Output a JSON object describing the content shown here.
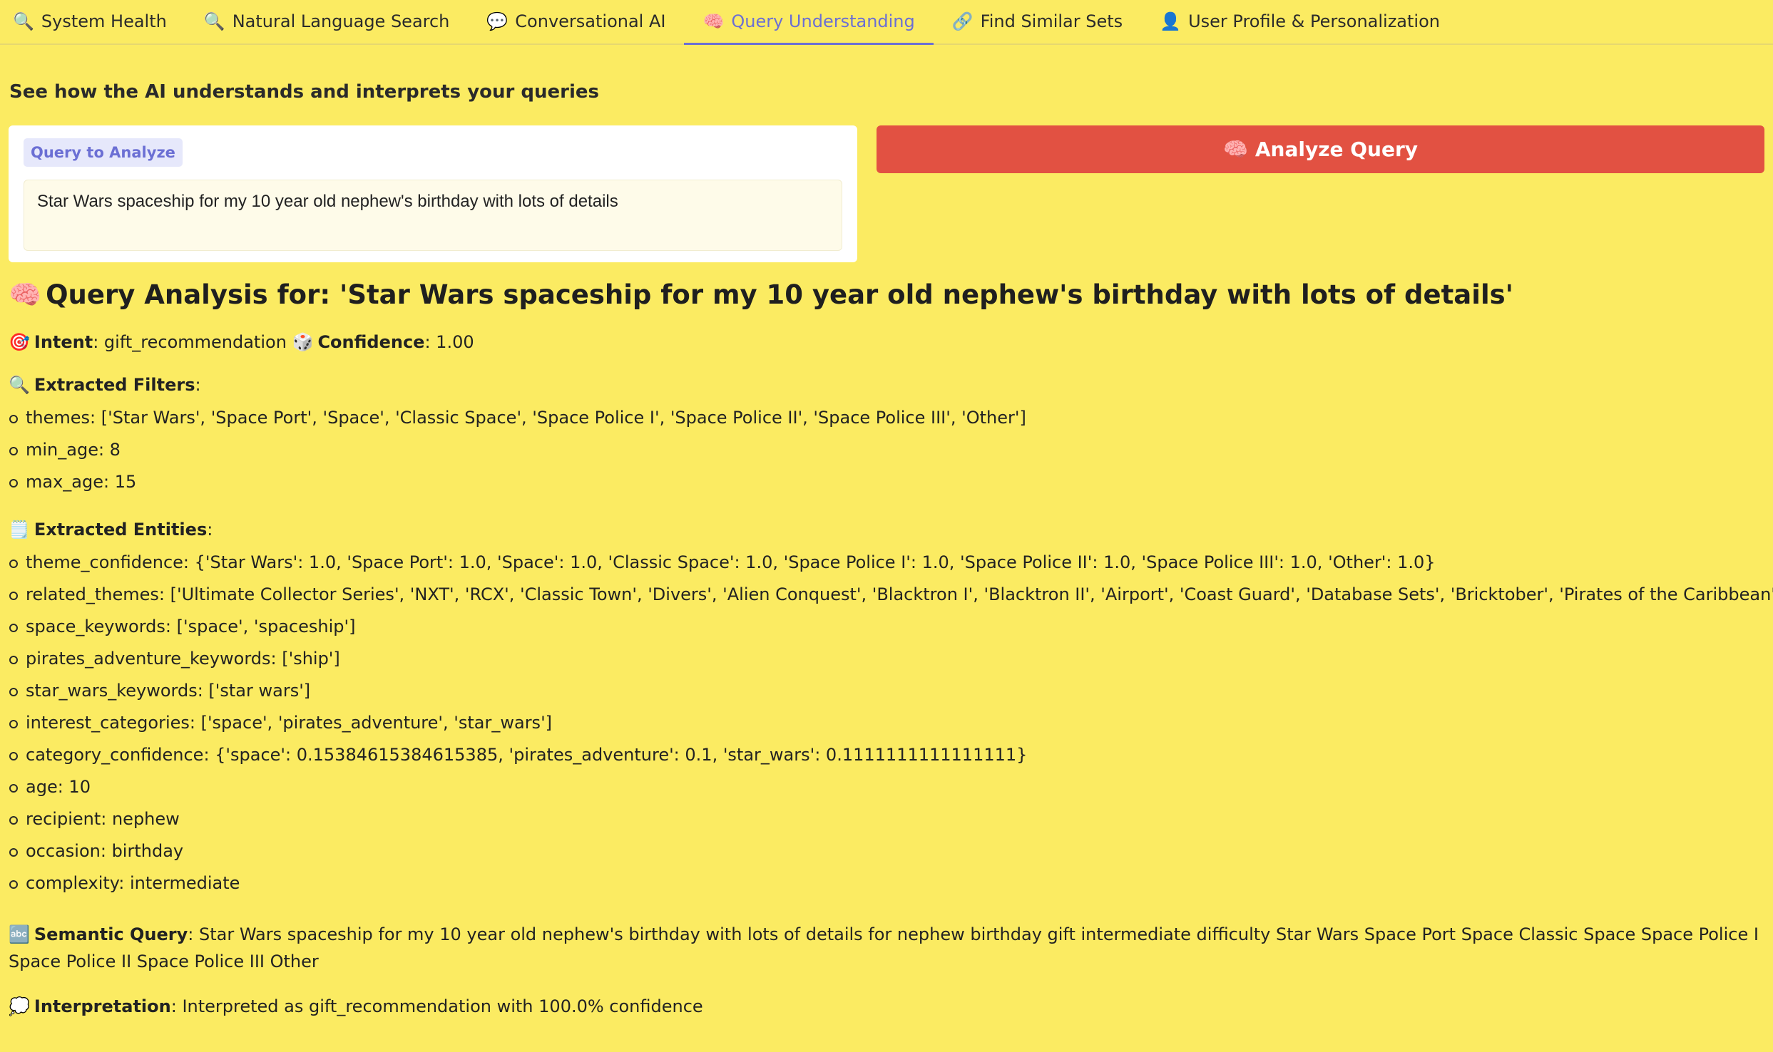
{
  "tabs": [
    {
      "icon": "🔍",
      "label": "System Health"
    },
    {
      "icon": "🔍",
      "label": "Natural Language Search"
    },
    {
      "icon": "💬",
      "label": "Conversational AI"
    },
    {
      "icon": "🧠",
      "label": "Query Understanding"
    },
    {
      "icon": "🔗",
      "label": "Find Similar Sets"
    },
    {
      "icon": "👤",
      "label": "User Profile & Personalization"
    }
  ],
  "active_tab": "Query Understanding",
  "subtitle": "See how the AI understands and interprets your queries",
  "query": {
    "label": "Query to Analyze",
    "value": "Star Wars spaceship for my 10 year old nephew's birthday with lots of details"
  },
  "analyze_button": {
    "icon": "🧠",
    "label": "Analyze Query"
  },
  "results": {
    "title_icon": "🧠",
    "title": "Query Analysis for: 'Star Wars spaceship for my 10 year old nephew's birthday with lots of details'",
    "intent_icon": "🎯",
    "intent_label": "Intent",
    "intent_value": ": gift_recommendation",
    "confidence_icon": "🎲",
    "confidence_label": "Confidence",
    "confidence_value": ": 1.00",
    "filters_icon": "🔍",
    "filters_label": "Extracted Filters",
    "filters": [
      "themes: ['Star Wars', 'Space Port', 'Space', 'Classic Space', 'Space Police I', 'Space Police II', 'Space Police III', 'Other']",
      "min_age: 8",
      "max_age: 15"
    ],
    "entities_icon": "🗒️",
    "entities_label": "Extracted Entities",
    "entities": [
      "theme_confidence: {'Star Wars': 1.0, 'Space Port': 1.0, 'Space': 1.0, 'Classic Space': 1.0, 'Space Police I': 1.0, 'Space Police II': 1.0, 'Space Police III': 1.0, 'Other': 1.0}",
      "related_themes: ['Ultimate Collector Series', 'NXT', 'RCX', 'Classic Town', 'Divers', 'Alien Conquest', 'Blacktron I', 'Blacktron II', 'Airport', 'Coast Guard', 'Database Sets', 'Bricktober', 'Pirates of the Caribbean']",
      "space_keywords: ['space', 'spaceship']",
      "pirates_adventure_keywords: ['ship']",
      "star_wars_keywords: ['star wars']",
      "interest_categories: ['space', 'pirates_adventure', 'star_wars']",
      "category_confidence: {'space': 0.15384615384615385, 'pirates_adventure': 0.1, 'star_wars': 0.1111111111111111}",
      "age: 10",
      "recipient: nephew",
      "occasion: birthday",
      "complexity: intermediate"
    ],
    "semantic_icon": "🔤",
    "semantic_label": "Semantic Query",
    "semantic_value": ": Star Wars spaceship for my 10 year old nephew's birthday with lots of details for nephew birthday gift intermediate difficulty Star Wars Space Port Space Classic Space Space Police I Space Police II Space Police III Other",
    "interpretation_icon": "💭",
    "interpretation_label": "Interpretation",
    "interpretation_value": ": Interpreted as gift_recommendation with 100.0% confidence"
  }
}
